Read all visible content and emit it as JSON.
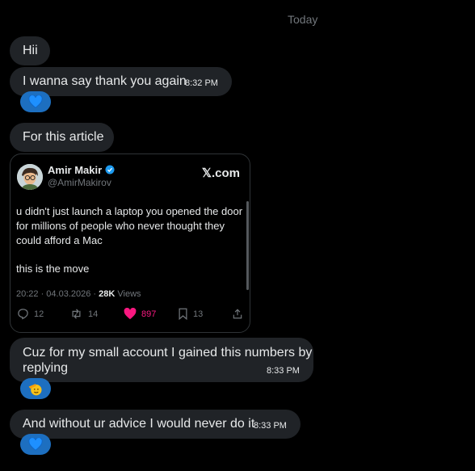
{
  "date_label": "Today",
  "messages": [
    {
      "text": "Hii"
    },
    {
      "text": "I wanna say thank you again",
      "time": "8:32 PM"
    },
    {
      "text": "For this article"
    },
    {
      "text_line1": "Cuz for my small account I gained this numbers by",
      "text_line2": "replying",
      "time": "8:33 PM"
    },
    {
      "text": "And without ur advice I would never do it",
      "time": "8:33 PM"
    }
  ],
  "reactions": [
    "blue-heart",
    "saluting-face",
    "blue-heart"
  ],
  "tweet": {
    "author": "Amir Makir",
    "handle": "@AmirMakirov",
    "source": "𝕏.com",
    "line1": "u didn't just launch a laptop you opened the door",
    "line2": "for millions of people who never thought they",
    "line3": "could afford a Mac",
    "line4": "this is the move",
    "timestamp": "20:22 · 04.03.2026 · ",
    "views_count": "28K",
    "views_label": " Views",
    "replies": "12",
    "reposts": "14",
    "likes": "897",
    "bookmarks": "13"
  },
  "colors": {
    "accent": "#1d9bf0",
    "like": "#f91880",
    "bubble": "#202327",
    "reaction_bg": "#1d6fc0"
  }
}
